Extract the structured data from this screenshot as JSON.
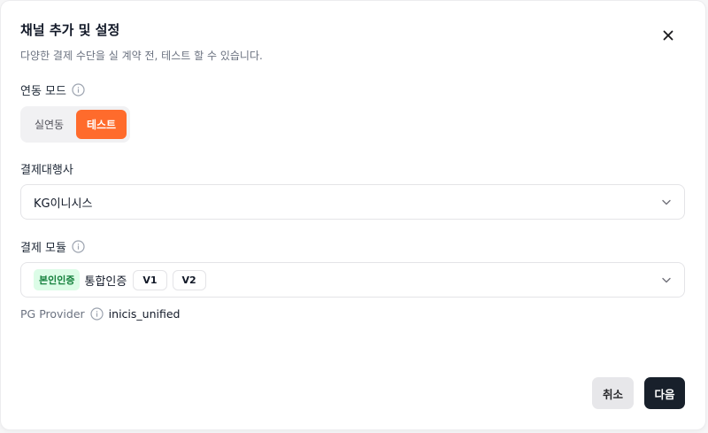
{
  "dialog": {
    "title": "채널 추가 및 설정",
    "subtitle": "다양한 결제 수단을 실 계약 전, 테스트 할 수 있습니다."
  },
  "mode": {
    "label": "연동 모드",
    "options": [
      "실연동",
      "테스트"
    ],
    "selected": "테스트"
  },
  "pg": {
    "label": "결제대행사",
    "value": "KG이니시스"
  },
  "module": {
    "label": "결제 모듈",
    "badge": "본인인증",
    "name": "통합인증",
    "versions": [
      "V1",
      "V2"
    ]
  },
  "provider": {
    "label": "PG Provider",
    "value": "inicis_unified"
  },
  "buttons": {
    "cancel": "취소",
    "next": "다음"
  },
  "colors": {
    "accent": "#ff6b2c",
    "primary_button": "#18202b",
    "badge_bg": "#dcfce7",
    "badge_text": "#15803d"
  },
  "icons": [
    "close-icon",
    "info-icon",
    "chevron-down-icon"
  ]
}
